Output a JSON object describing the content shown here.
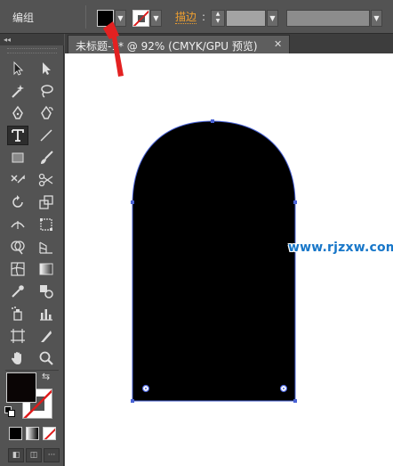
{
  "control_bar": {
    "selection_type": "编组",
    "fill_color": "#000000",
    "stroke_color": "none",
    "stroke_label": "描边",
    "stroke_colon": ":",
    "stroke_weight": "",
    "variable_width_profile": ""
  },
  "tools_panel": {
    "collapse_glyph": "◂◂",
    "active_tool": "type-tool",
    "fill_color": "#0a0505",
    "stroke_color": "none"
  },
  "document": {
    "tab_title": "未标题-1* @ 92% (CMYK/GPU 预览)",
    "close_glyph": "✕",
    "zoom_percent": 92,
    "color_mode": "CMYK/GPU 预览"
  },
  "artwork": {
    "shape": "arch",
    "fill": "#000000",
    "selection_color": "#4a63d6"
  },
  "watermark": {
    "text": "www.rjzxw.com"
  },
  "annotation": {
    "arrow_color": "#e32121"
  },
  "colors": {
    "panel_bg": "#535353",
    "canvas_bg": "#ffffff",
    "accent_orange": "#f0a030"
  }
}
